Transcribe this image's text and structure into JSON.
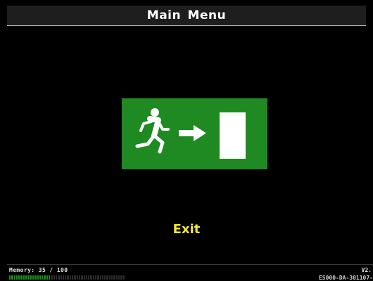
{
  "header": {
    "title": "Main Menu"
  },
  "main": {
    "selected_item": {
      "icon": "emergency-exit-icon",
      "label": "Exit"
    }
  },
  "status": {
    "memory_text": "Memory: 35 / 100",
    "memory_used": 35,
    "memory_total": 100,
    "version_text": "V2.",
    "build_text": "ES000-DA-301107-"
  },
  "colors": {
    "background": "#000000",
    "sign_green": "#1f8a21",
    "label_yellow": "#f2e63a",
    "title_text": "#ffffff"
  }
}
